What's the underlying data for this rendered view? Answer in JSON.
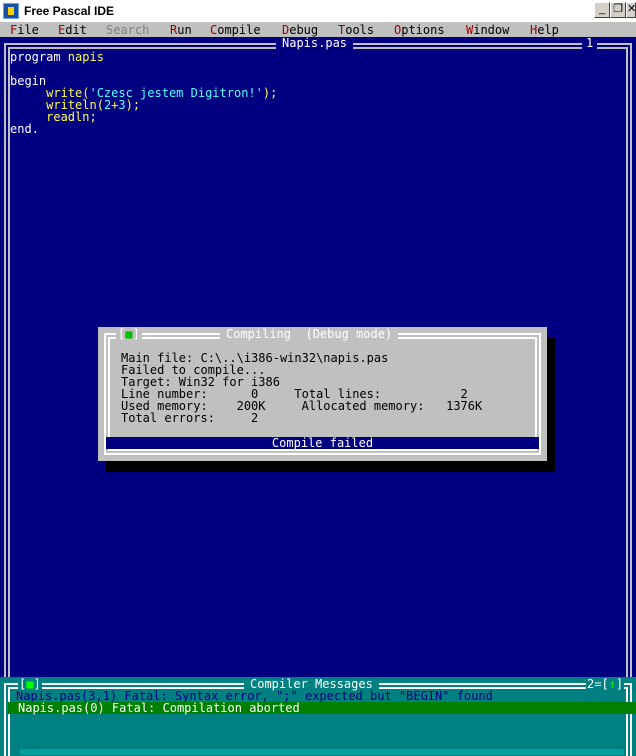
{
  "window": {
    "title": "Free Pascal IDE",
    "buttons": {
      "minimize": "_",
      "restore": "❐",
      "close": "✕"
    }
  },
  "menu": [
    {
      "label": "File",
      "hot": "F",
      "rest": "ile",
      "disabled": false
    },
    {
      "label": "Edit",
      "hot": "E",
      "rest": "dit",
      "disabled": false
    },
    {
      "label": "Search",
      "hot": "S",
      "rest": "earch",
      "disabled": true
    },
    {
      "label": "Run",
      "hot": "R",
      "rest": "un",
      "disabled": false
    },
    {
      "label": "Compile",
      "hot": "C",
      "rest": "ompile",
      "disabled": false
    },
    {
      "label": "Debug",
      "hot": "D",
      "rest": "ebug",
      "disabled": false
    },
    {
      "label": "Tools",
      "hot": "T",
      "rest": "ools",
      "disabled": false
    },
    {
      "label": "Options",
      "hot": "O",
      "rest": "ptions",
      "disabled": false
    },
    {
      "label": "Window",
      "hot": "W",
      "rest": "indow",
      "disabled": false
    },
    {
      "label": "Help",
      "hot": "H",
      "rest": "elp",
      "disabled": false
    }
  ],
  "editor": {
    "title": "Napis.pas",
    "window_number": "1",
    "code": {
      "l1_kw": "program ",
      "l1_id": "napis",
      "l3_kw": "begin",
      "l4_indent": "     ",
      "l4_id": "write",
      "l4_open": "(",
      "l4_str": "'Czesc jestem Digitron!'",
      "l4_close": ");",
      "l5_indent": "     ",
      "l5_id": "writeln",
      "l5_open": "(",
      "l5_n1": "2",
      "l5_op": "+",
      "l5_n2": "3",
      "l5_close": ");",
      "l6_indent": "     ",
      "l6_id": "readln;",
      "l7_kw": "end."
    }
  },
  "dialog": {
    "close_left": "[",
    "close_mark": "■",
    "close_right": "]",
    "title": "Compiling  (Debug mode)",
    "lines": [
      "Main file: C:\\..\\i386-win32\\napis.pas",
      "Failed to compile...",
      "Target: Win32 for i386",
      "Line number:      0     Total lines:           2",
      "Used memory:    200K     Allocated memory:   1376K",
      "Total errors:     2"
    ],
    "status": "Compile failed"
  },
  "messages": {
    "title": "Compiler Messages",
    "close_left": "[",
    "close_mark": "■",
    "close_right": "]",
    "right_num": "2",
    "right_eq": "=[",
    "right_arrow": "↑",
    "right_end": "]",
    "items": [
      "Napis.pas(3,1) Fatal: Syntax error, \";\" expected but \"BEGIN\" found",
      "Napis.pas(0) Fatal: Compilation aborted"
    ]
  },
  "colors": {
    "desktop": "#000080",
    "menu": "#c0c0c0",
    "dialog": "#c0c0c0",
    "messages": "#008080",
    "selected_message": "#008000"
  }
}
